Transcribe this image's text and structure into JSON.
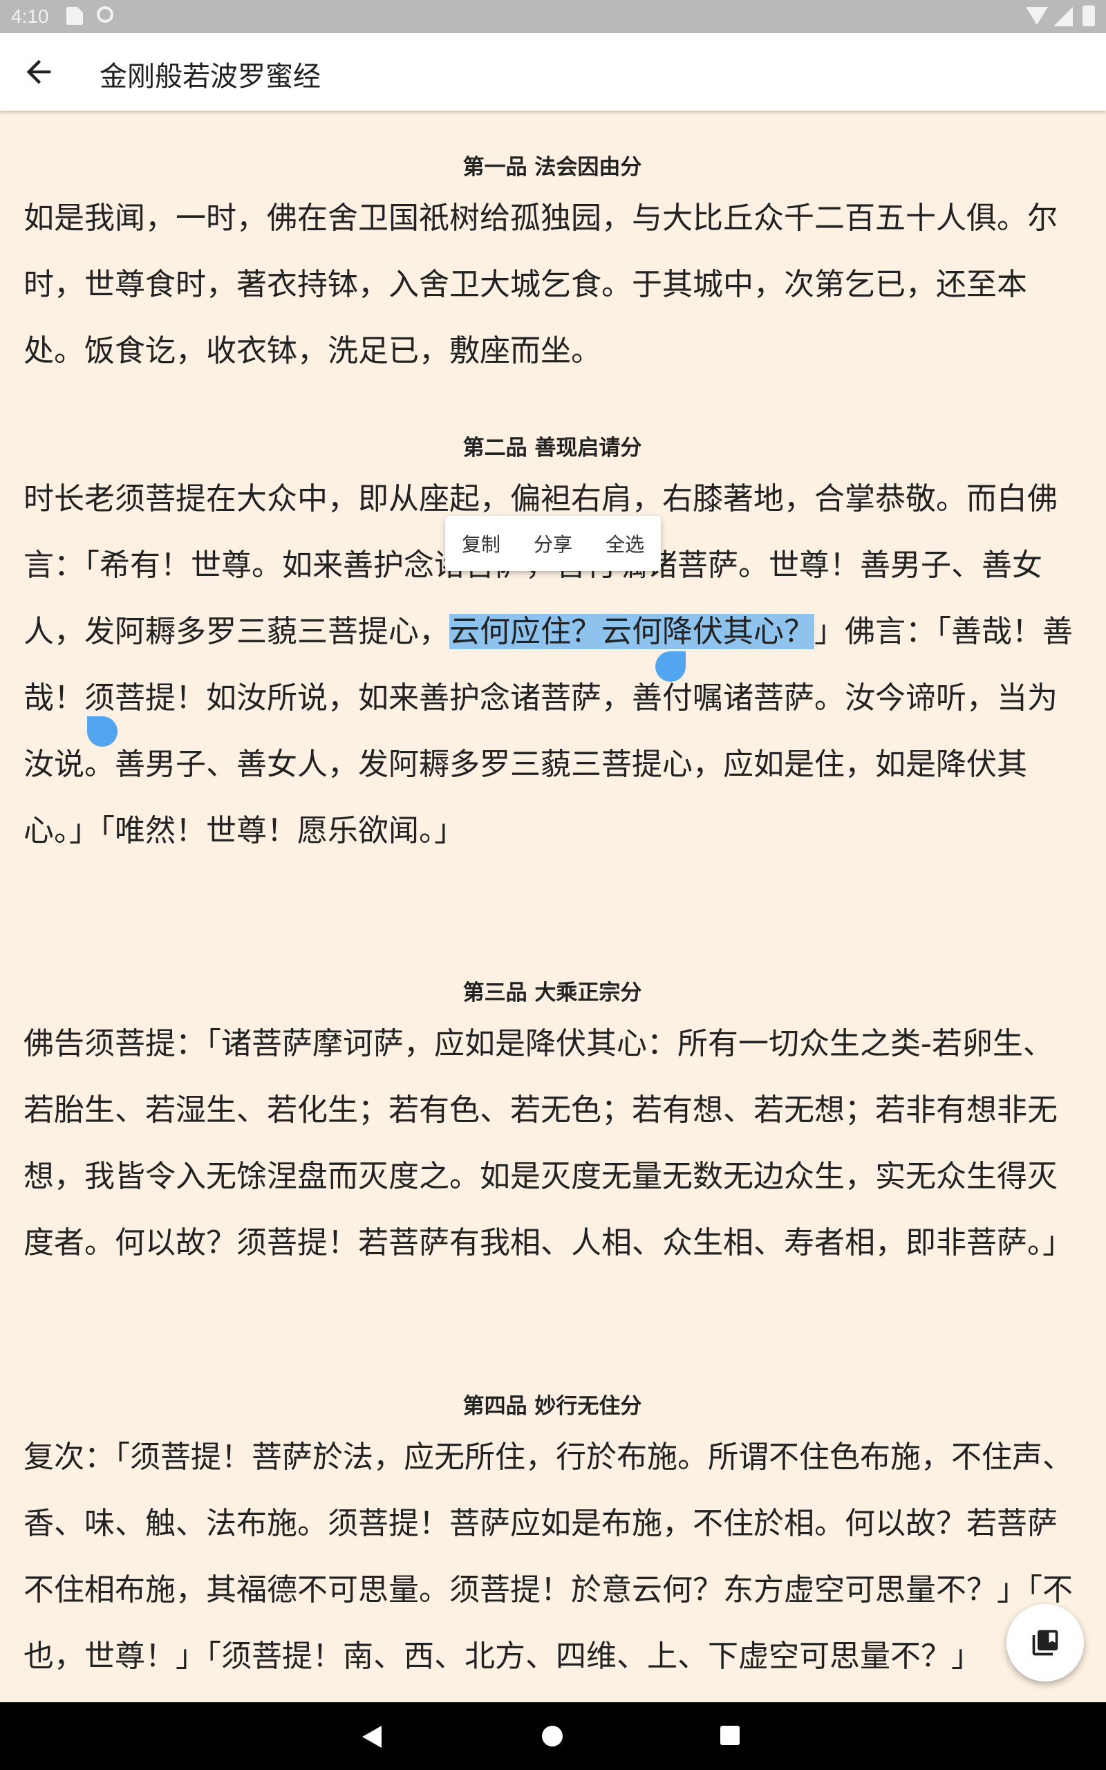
{
  "status_bar": {
    "time": "4:10"
  },
  "app_bar": {
    "title": "金刚般若波罗蜜经"
  },
  "selection_toolbar": {
    "copy": "复制",
    "share": "分享",
    "select_all": "全选"
  },
  "chapters": [
    {
      "title": "第一品 法会因由分",
      "text": "如是我闻，一时，佛在舍卫国祇树给孤独园，与大比丘众千二百五十人俱。尔时，世尊食时，著衣持钵，入舍卫大城乞食。于其城中，次第乞已，还至本处。饭食讫，收衣钵，洗足已，敷座而坐。"
    },
    {
      "title": "第二品 善现启请分",
      "text_before": "时长老须菩提在大众中，即从座起，偏袒右肩，右膝著地，合掌恭敬。而白佛言：「希有！世尊。如来善护念诸菩萨，善付嘱诸菩萨。世尊！善男子、善女人，发阿耨多罗三藐三菩提心，",
      "text_selected": "云何应住？云何降伏其心？",
      "text_after": "」佛言：「善哉！善哉！须菩提！如汝所说，如来善护念诸菩萨，善付嘱诸菩萨。汝今谛听，当为汝说。善男子、善女人，发阿耨多罗三藐三菩提心，应如是住，如是降伏其心。」「唯然！世尊！愿乐欲闻。」"
    },
    {
      "title": "第三品 大乘正宗分",
      "text": "佛告须菩提：「诸菩萨摩诃萨，应如是降伏其心：所有一切众生之类-若卵生、若胎生、若湿生、若化生；若有色、若无色；若有想、若无想；若非有想非无想，我皆令入无馀涅盘而灭度之。如是灭度无量无数无边众生，实无众生得灭度者。何以故？须菩提！若菩萨有我相、人相、众生相、寿者相，即非菩萨。」"
    },
    {
      "title": "第四品 妙行无住分",
      "text": "复次：「须菩提！菩萨於法，应无所住，行於布施。所谓不住色布施，不住声、香、味、触、法布施。须菩提！菩萨应如是布施，不住於相。何以故？若菩萨不住相布施，其福德不可思量。须菩提！於意云何？东方虚空可思量不？」「不也，世尊！」「须菩提！南、西、北方、四维、上、下虚空可思量不？」"
    }
  ],
  "icons": {
    "back": "arrow-back-icon",
    "fab": "bookmarks-icon"
  }
}
